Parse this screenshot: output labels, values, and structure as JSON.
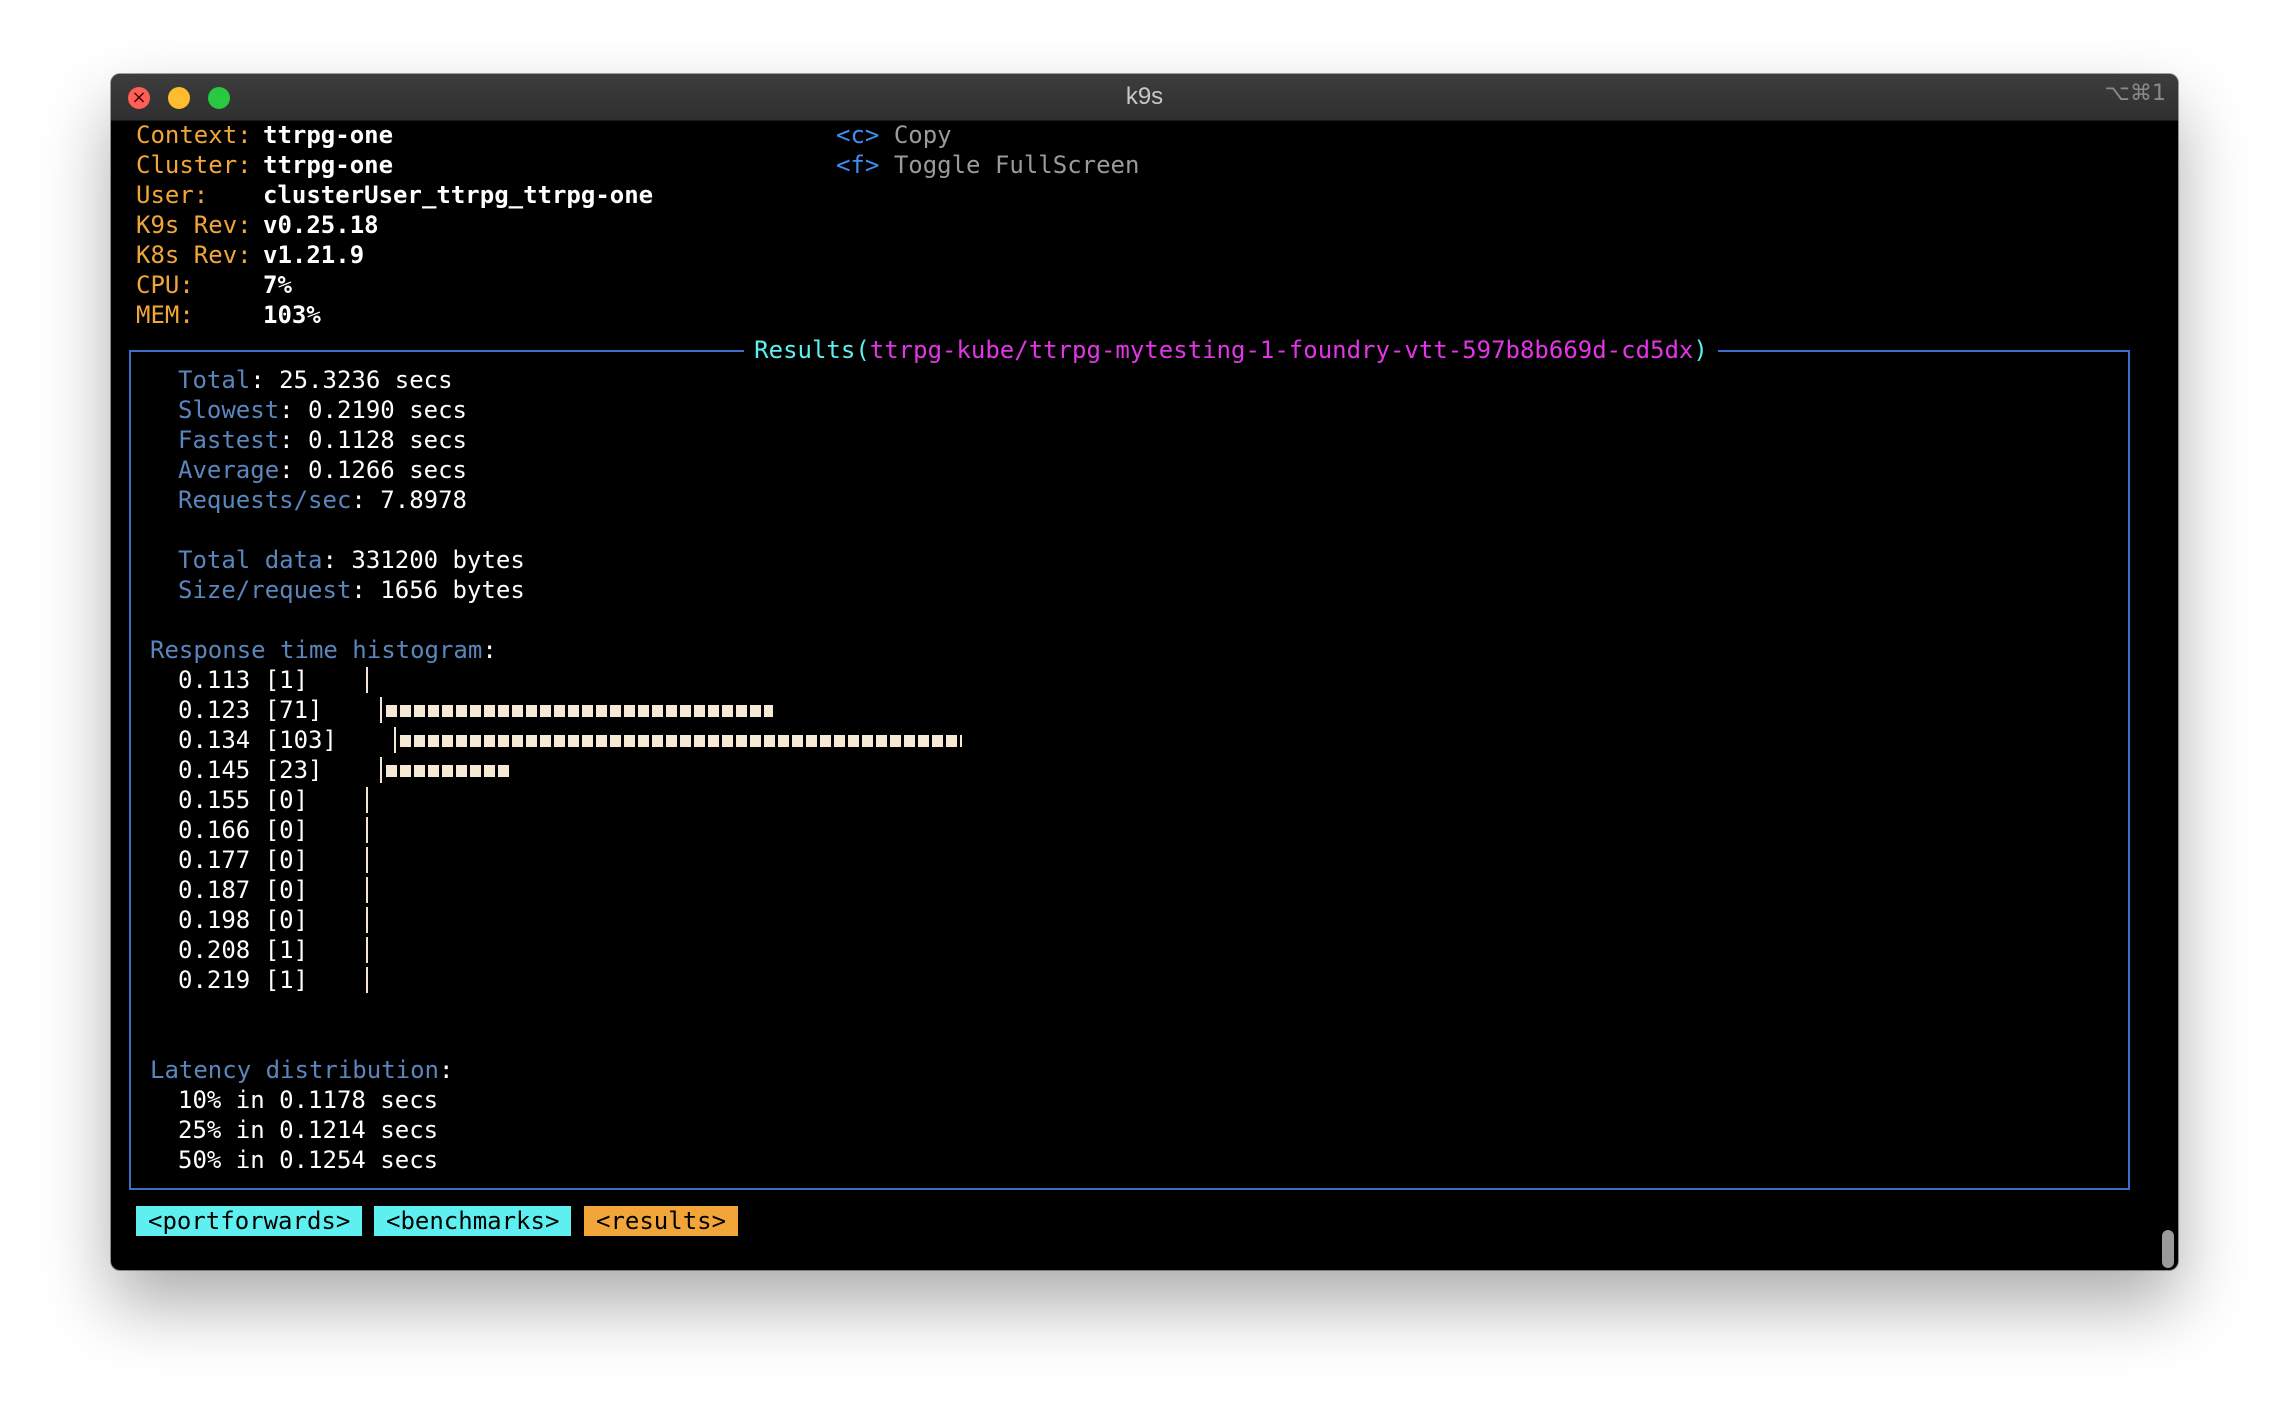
{
  "window": {
    "title": "k9s",
    "shortcut": "⌥⌘1"
  },
  "header": {
    "info": [
      {
        "key": "Context:",
        "value": "ttrpg-one"
      },
      {
        "key": "Cluster:",
        "value": "ttrpg-one"
      },
      {
        "key": "User:",
        "value": "clusterUser_ttrpg_ttrpg-one"
      },
      {
        "key": "K9s Rev:",
        "value": "v0.25.18"
      },
      {
        "key": "K8s Rev:",
        "value": "v1.21.9"
      },
      {
        "key": "CPU:",
        "value": "7%"
      },
      {
        "key": "MEM:",
        "value": "103%"
      }
    ],
    "hotkeys": [
      {
        "key": "<c>",
        "label": "Copy"
      },
      {
        "key": "<f>",
        "label": "Toggle FullScreen"
      }
    ]
  },
  "results": {
    "title_prefix": "Results(",
    "title_path": "ttrpg-kube/ttrpg-mytesting-1-foundry-vtt-597b8b669d-cd5dx",
    "title_suffix": ")",
    "summary": [
      {
        "key": "Total",
        "value": ": 25.3236 secs"
      },
      {
        "key": "Slowest",
        "value": ": 0.2190 secs"
      },
      {
        "key": "Fastest",
        "value": ": 0.1128 secs"
      },
      {
        "key": "Average",
        "value": ": 0.1266 secs"
      },
      {
        "key": "Requests/sec",
        "value": ": 7.8978"
      }
    ],
    "data": [
      {
        "key": "Total data",
        "value": ": 331200 bytes"
      },
      {
        "key": "Size/request",
        "value": ": 1656 bytes"
      }
    ],
    "histogram_heading": "Response time histogram",
    "histogram": [
      {
        "label": "0.113 [1]",
        "count": 1
      },
      {
        "label": "0.123 [71]",
        "count": 71
      },
      {
        "label": "0.134 [103]",
        "count": 103
      },
      {
        "label": "0.145 [23]",
        "count": 23
      },
      {
        "label": "0.155 [0]",
        "count": 0
      },
      {
        "label": "0.166 [0]",
        "count": 0
      },
      {
        "label": "0.177 [0]",
        "count": 0
      },
      {
        "label": "0.187 [0]",
        "count": 0
      },
      {
        "label": "0.198 [0]",
        "count": 0
      },
      {
        "label": "0.208 [1]",
        "count": 1
      },
      {
        "label": "0.219 [1]",
        "count": 1
      }
    ],
    "latency_heading": "Latency distribution",
    "latency": [
      "10% in 0.1178 secs",
      "25% in 0.1214 secs",
      "50% in 0.1254 secs"
    ]
  },
  "tabs": [
    {
      "label": "<portforwards>",
      "active": false
    },
    {
      "label": "<benchmarks>",
      "active": false
    },
    {
      "label": "<results>",
      "active": true
    }
  ],
  "colors": {
    "label_orange": "#f2a63a",
    "hotkey_blue": "#3e8ef5",
    "field_steel": "#5a86bd",
    "title_cyan": "#5ef0f0",
    "title_magenta": "#e236e6",
    "bar_cream": "#f6ead4"
  }
}
